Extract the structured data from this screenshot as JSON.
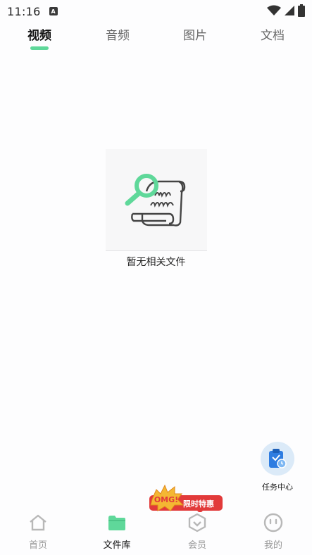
{
  "status_bar": {
    "time": "11:16",
    "notification_letter": "A"
  },
  "tabs": [
    {
      "label": "视频",
      "active": true
    },
    {
      "label": "音频",
      "active": false
    },
    {
      "label": "图片",
      "active": false
    },
    {
      "label": "文档",
      "active": false
    }
  ],
  "empty_state": {
    "message": "暂无相关文件"
  },
  "task_center": {
    "label": "任务中心"
  },
  "promo": {
    "burst_text": "OMG!",
    "label": "限时特惠"
  },
  "bottom_nav": [
    {
      "label": "首页",
      "active": false
    },
    {
      "label": "文件库",
      "active": true
    },
    {
      "label": "会员",
      "active": false
    },
    {
      "label": "我的",
      "active": false
    }
  ],
  "colors": {
    "accent": "#5fd89a",
    "promo_red": "#e23a3a",
    "task_blue": "#2f7de1"
  }
}
